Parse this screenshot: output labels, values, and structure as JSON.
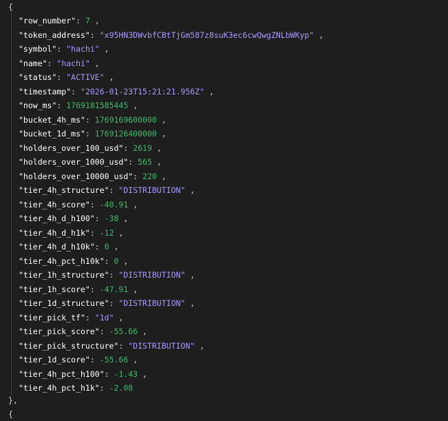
{
  "json_viewer": {
    "open_brace": "{",
    "close_brace": "},",
    "next_open_brace": "{",
    "entries": [
      {
        "key": "\"row_number\"",
        "value": "7",
        "type": "number"
      },
      {
        "key": "\"token_address\"",
        "value": "\"x95HN3DWvbfCBtTjGm587z8suK3ec6cwQwgZNLbWKyp\"",
        "type": "string"
      },
      {
        "key": "\"symbol\"",
        "value": "\"hachi\"",
        "type": "string"
      },
      {
        "key": "\"name\"",
        "value": "\"hachi\"",
        "type": "string"
      },
      {
        "key": "\"status\"",
        "value": "\"ACTIVE\"",
        "type": "string"
      },
      {
        "key": "\"timestamp\"",
        "value": "\"2026-01-23T15:21:21.956Z\"",
        "type": "string"
      },
      {
        "key": "\"now_ms\"",
        "value": "1769181585445",
        "type": "number"
      },
      {
        "key": "\"bucket_4h_ms\"",
        "value": "1769169600000",
        "type": "number"
      },
      {
        "key": "\"bucket_1d_ms\"",
        "value": "1769126400000",
        "type": "number"
      },
      {
        "key": "\"holders_over_100_usd\"",
        "value": "2619",
        "type": "number"
      },
      {
        "key": "\"holders_over_1000_usd\"",
        "value": "565",
        "type": "number"
      },
      {
        "key": "\"holders_over_10000_usd\"",
        "value": "220",
        "type": "number"
      },
      {
        "key": "\"tier_4h_structure\"",
        "value": "\"DISTRIBUTION\"",
        "type": "string"
      },
      {
        "key": "\"tier_4h_score\"",
        "value": "-40.91",
        "type": "number"
      },
      {
        "key": "\"tier_4h_d_h100\"",
        "value": "-38",
        "type": "number"
      },
      {
        "key": "\"tier_4h_d_h1k\"",
        "value": "-12",
        "type": "number"
      },
      {
        "key": "\"tier_4h_d_h10k\"",
        "value": "0",
        "type": "number"
      },
      {
        "key": "\"tier_4h_pct_h10k\"",
        "value": "0",
        "type": "number"
      },
      {
        "key": "\"tier_1h_structure\"",
        "value": "\"DISTRIBUTION\"",
        "type": "string"
      },
      {
        "key": "\"tier_1h_score\"",
        "value": "-47.91",
        "type": "number"
      },
      {
        "key": "\"tier_1d_structure\"",
        "value": "\"DISTRIBUTION\"",
        "type": "string"
      },
      {
        "key": "\"tier_pick_tf\"",
        "value": "\"1d\"",
        "type": "string"
      },
      {
        "key": "\"tier_pick_score\"",
        "value": "-55.66",
        "type": "number"
      },
      {
        "key": "\"tier_pick_structure\"",
        "value": "\"DISTRIBUTION\"",
        "type": "string"
      },
      {
        "key": "\"tier_1d_score\"",
        "value": "-55.66",
        "type": "number"
      },
      {
        "key": "\"tier_4h_pct_h100\"",
        "value": "-1.43",
        "type": "number"
      },
      {
        "key": "\"tier_4h_pct_h1k\"",
        "value": "-2.08",
        "type": "number"
      }
    ]
  }
}
